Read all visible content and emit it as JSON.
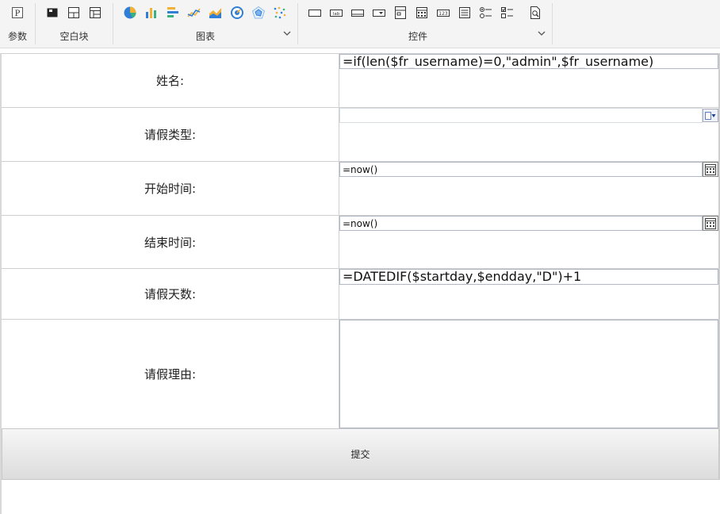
{
  "toolbar": {
    "groups": [
      {
        "label": "参数"
      },
      {
        "label": "空白块"
      },
      {
        "label": "图表"
      },
      {
        "label": "控件"
      }
    ],
    "icons": {
      "param": "parameter-icon",
      "blank": [
        "absolute-layout-icon",
        "split-layout-icon",
        "grid-layout-icon"
      ],
      "chart": [
        "pie-chart-icon",
        "bar-chart-icon",
        "horizontal-bar-icon",
        "line-chart-icon",
        "area-chart-icon",
        "gauge-chart-icon",
        "radar-chart-icon",
        "scatter-chart-icon"
      ],
      "widget": [
        "text-field-icon",
        "label-icon",
        "button-icon",
        "dropdown-icon",
        "dropdown-tree-icon",
        "date-icon",
        "number-icon",
        "list-icon",
        "radio-group-icon",
        "checkbox-group-icon",
        "preview-icon"
      ]
    }
  },
  "form": {
    "rows": [
      {
        "label": "姓名:",
        "value": "=if(len($fr_username)=0,\"admin\",$fr_username)",
        "kind": "text"
      },
      {
        "label": "请假类型:",
        "value": "",
        "kind": "combo"
      },
      {
        "label": "开始时间:",
        "value": "=now()",
        "kind": "date"
      },
      {
        "label": "结束时间:",
        "value": "=now()",
        "kind": "date"
      },
      {
        "label": "请假天数:",
        "value": "=DATEDIF($startday,$endday,\"D\")+1",
        "kind": "text"
      },
      {
        "label": "请假理由:",
        "value": "",
        "kind": "textarea"
      }
    ],
    "submit_label": "提交"
  },
  "colors": {
    "toolbar_bg": "#f4f4f4",
    "border": "#cfcfcf",
    "field_border": "#b0b8c8",
    "accent_blue": "#2f7fd8"
  }
}
